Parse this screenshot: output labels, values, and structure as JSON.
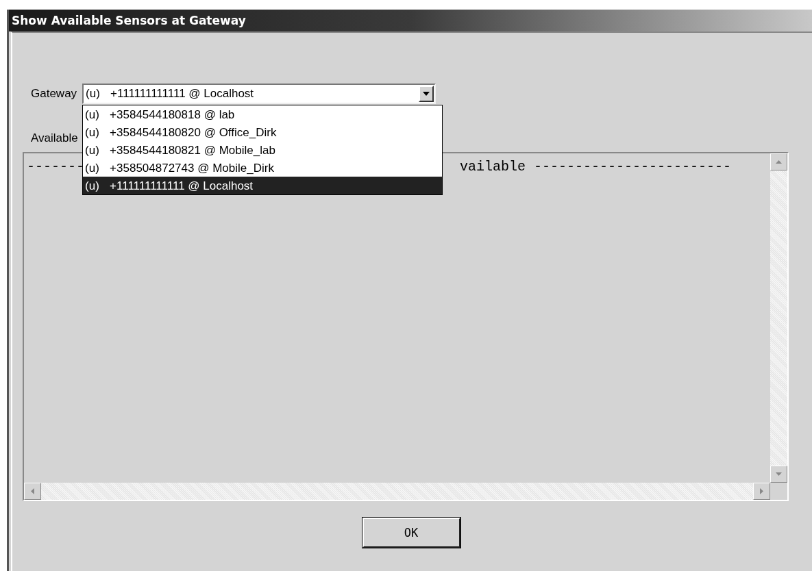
{
  "window": {
    "title": "Show Available Sensors at Gateway"
  },
  "gateway": {
    "label": "Gateway",
    "value_prefix": "(u)",
    "value": "+111111111111 @ Localhost",
    "expanded": true,
    "options": [
      {
        "prefix": "(u)",
        "text": "+3584544180818 @ lab",
        "selected": false
      },
      {
        "prefix": "(u)",
        "text": "+3584544180820 @ Office_Dirk",
        "selected": false
      },
      {
        "prefix": "(u)",
        "text": "+3584544180821 @ Mobile_lab",
        "selected": false
      },
      {
        "prefix": "(u)",
        "text": "+358504872743 @ Mobile_Dirk",
        "selected": false
      },
      {
        "prefix": "(u)",
        "text": "+111111111111 @ Localhost",
        "selected": true
      }
    ]
  },
  "sensors": {
    "label": "Available",
    "text_left": "-------",
    "text_right": "vailable ------------------------"
  },
  "buttons": [
    {
      "label": "OK"
    }
  ]
}
